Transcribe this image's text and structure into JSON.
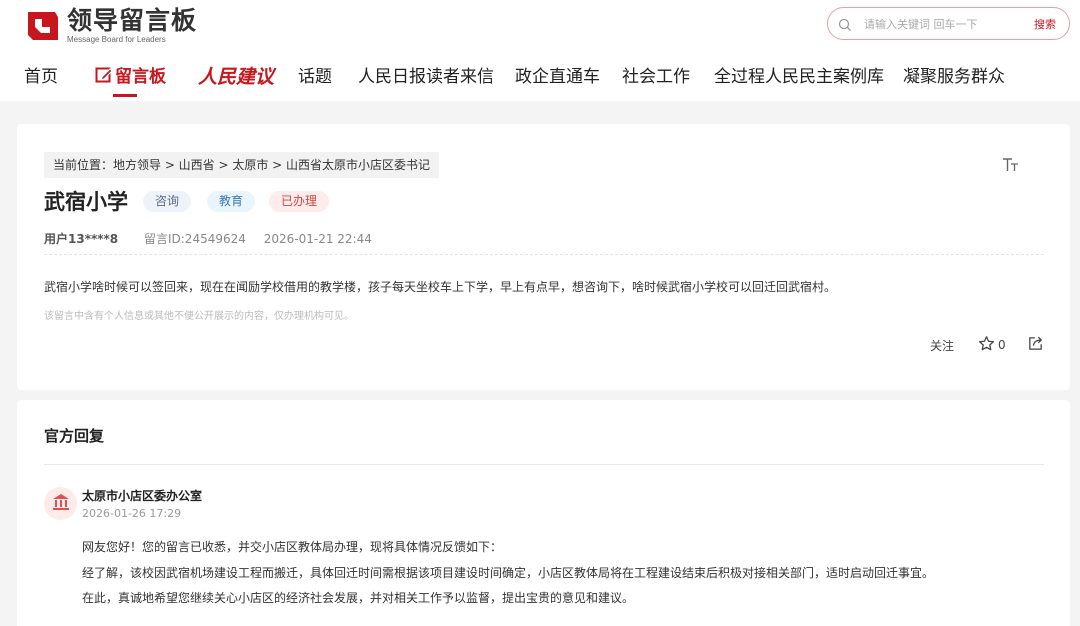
{
  "header": {
    "logo_title": "领导留言板",
    "logo_subtitle": "Message Board for Leaders",
    "search_placeholder": "请输入关键词 回车一下",
    "search_button": "搜索"
  },
  "nav": {
    "items": [
      {
        "label": "首页"
      },
      {
        "label": "留言板",
        "active": true
      },
      {
        "label": "人民建议"
      },
      {
        "label": "话题"
      },
      {
        "label": "人民日报读者来信"
      },
      {
        "label": "政企直通车"
      },
      {
        "label": "社会工作"
      },
      {
        "label": "全过程人民民主案例库"
      },
      {
        "label": "凝聚服务群众"
      }
    ]
  },
  "message": {
    "breadcrumb": "当前位置：地方领导 > 山西省 > 太原市 > 山西省太原市小店区委书记",
    "font_size_icon": "TT",
    "title": "武宿小学",
    "tags": [
      "咨询",
      "教育",
      "已办理"
    ],
    "user": "用户13****8",
    "message_id": "留言ID:24549624",
    "datetime": "2026-01-21 22:44",
    "body": "武宿小学啥时候可以签回来，现在在闻励学校借用的教学楼，孩子每天坐校车上下学，早上有点早，想咨询下，啥时候武宿小学校可以回迁回武宿村。",
    "privacy_note": "该留言中含有个人信息或其他不便公开展示的内容，仅办理机构可见。",
    "follow_label": "关注",
    "star_count": "0"
  },
  "reply": {
    "heading": "官方回复",
    "org": "太原市小店区委办公室",
    "time": "2026-01-26 17:29",
    "lines": [
      "网友您好！您的留言已收悉，并交小店区教体局办理，现将具体情况反馈如下：",
      "经了解，该校因武宿机场建设工程而搬迁，具体回迁时间需根据该项目建设时间确定，小店区教体局将在工程建设结束后积极对接相关部门，适时启动回迁事宜。",
      "在此，真诚地希望您继续关心小店区的经济社会发展，并对相关工作予以监督，提出宝贵的意见和建议。"
    ]
  },
  "colors": {
    "brand_red": "#c7161e",
    "tag_consult_bg": "#eef3f9",
    "tag_edu_bg": "#e9f4fb",
    "tag_done_bg": "#fdeceb"
  },
  "icons": [
    "logo-icon",
    "search-icon",
    "edit-icon",
    "font-size-icon",
    "star-icon",
    "share-icon",
    "building-icon"
  ]
}
